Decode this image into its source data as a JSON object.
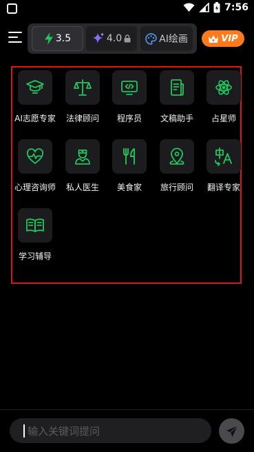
{
  "status_bar": {
    "time": "7:56"
  },
  "models": [
    {
      "label": "3.5",
      "icon": "lightning-icon",
      "active": true
    },
    {
      "label": "4.0",
      "icon": "sparkle-icon",
      "locked": true
    },
    {
      "label": "AI绘画",
      "icon": "palette-icon"
    }
  ],
  "vip_label": "VIP",
  "tools": [
    {
      "label": "AI志愿专家",
      "icon": "graduation-cap-icon"
    },
    {
      "label": "法律顾问",
      "icon": "scales-icon"
    },
    {
      "label": "程序员",
      "icon": "code-monitor-icon"
    },
    {
      "label": "文稿助手",
      "icon": "document-icon"
    },
    {
      "label": "占星师",
      "icon": "atom-icon"
    },
    {
      "label": "心理咨询师",
      "icon": "heart-pulse-icon"
    },
    {
      "label": "私人医生",
      "icon": "doctor-icon"
    },
    {
      "label": "美食家",
      "icon": "fork-knife-icon"
    },
    {
      "label": "旅行顾问",
      "icon": "map-pin-icon"
    },
    {
      "label": "翻译专家",
      "icon": "translate-icon"
    },
    {
      "label": "学习辅导",
      "icon": "open-book-icon"
    }
  ],
  "input": {
    "placeholder": "输入关键词提问"
  },
  "colors": {
    "accent_green": "#22c55e",
    "vip_orange": "#ff7a1a",
    "highlight_red": "#e01414"
  }
}
